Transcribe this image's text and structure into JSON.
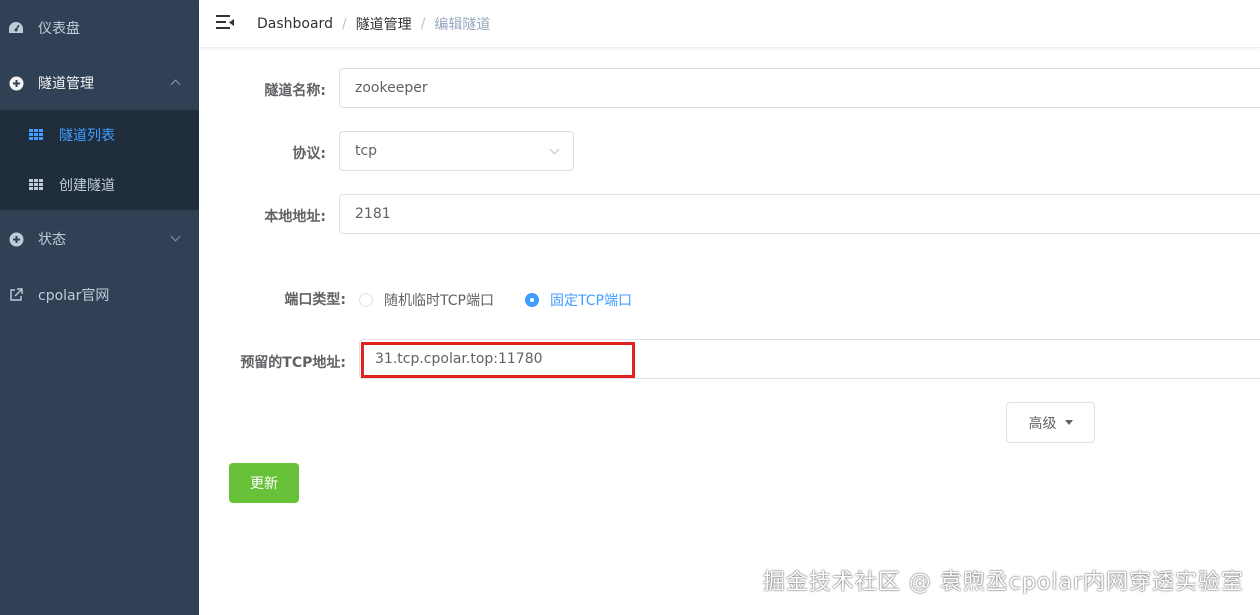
{
  "sidebar": {
    "dashboard_label": "仪表盘",
    "tunnel_mgmt_label": "隧道管理",
    "tunnel_list_label": "隧道列表",
    "create_tunnel_label": "创建隧道",
    "status_label": "状态",
    "official_site_label": "cpolar官网"
  },
  "breadcrumb": {
    "home": "Dashboard",
    "section": "隧道管理",
    "current": "编辑隧道"
  },
  "form": {
    "name_label": "隧道名称:",
    "name_value": "zookeeper",
    "protocol_label": "协议:",
    "protocol_value": "tcp",
    "local_addr_label": "本地地址:",
    "local_addr_value": "2181",
    "port_type_label": "端口类型:",
    "port_type_options": [
      "随机临时TCP端口",
      "固定TCP端口"
    ],
    "port_type_selected": "固定TCP端口",
    "reserved_addr_label": "预留的TCP地址:",
    "reserved_addr_value": "31.tcp.cpolar.top:11780",
    "advanced_label": "高级",
    "update_label": "更新"
  },
  "watermark": "掘金技术社区 @ 袁煦丞cpolar内网穿透实验室",
  "colors": {
    "sidebar_bg": "#304156",
    "submenu_bg": "#1f2d3d",
    "accent": "#409eff",
    "success": "#67c23a",
    "highlight_box": "#e1221f"
  }
}
